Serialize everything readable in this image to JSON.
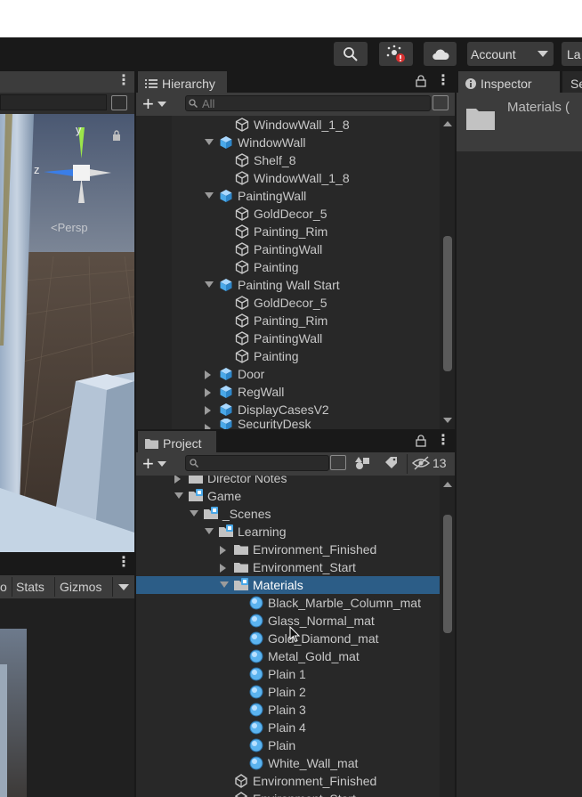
{
  "toolbar": {
    "account_label": "Account",
    "layers_label": "La",
    "search_icon": "search-icon",
    "collab_icon": "collab-icon",
    "cloud_icon": "cloud-icon"
  },
  "scene": {
    "gizmo_y": "y",
    "gizmo_z": "z",
    "persp_label": "<Persp"
  },
  "game": {
    "toolbar_partial": "o",
    "stats_label": "Stats",
    "gizmos_label": "Gizmos"
  },
  "hierarchy": {
    "tab_label": "Hierarchy",
    "search_placeholder": "All",
    "items": [
      {
        "label": "WindowWall_1_8",
        "type": "mesh"
      },
      {
        "label": "WindowWall",
        "type": "prefab"
      },
      {
        "label": "Shelf_8",
        "type": "mesh"
      },
      {
        "label": "WindowWall_1_8",
        "type": "mesh"
      },
      {
        "label": "PaintingWall",
        "type": "prefab"
      },
      {
        "label": "GoldDecor_5",
        "type": "mesh"
      },
      {
        "label": "Painting_Rim",
        "type": "mesh"
      },
      {
        "label": "PaintingWall",
        "type": "mesh"
      },
      {
        "label": "Painting",
        "type": "mesh"
      },
      {
        "label": "Painting Wall Start",
        "type": "prefab"
      },
      {
        "label": "GoldDecor_5",
        "type": "mesh"
      },
      {
        "label": "Painting_Rim",
        "type": "mesh"
      },
      {
        "label": "PaintingWall",
        "type": "mesh"
      },
      {
        "label": "Painting",
        "type": "mesh"
      },
      {
        "label": "Door",
        "type": "prefab"
      },
      {
        "label": "RegWall",
        "type": "prefab"
      },
      {
        "label": "DisplayCasesV2",
        "type": "prefab"
      },
      {
        "label": "SecurityDesk",
        "type": "prefab"
      }
    ]
  },
  "project": {
    "tab_label": "Project",
    "hidden_count": "13",
    "items": [
      {
        "label": "Director Notes",
        "type": "folder"
      },
      {
        "label": "Game",
        "type": "folder-scene"
      },
      {
        "label": "_Scenes",
        "type": "folder-scene"
      },
      {
        "label": "Learning",
        "type": "folder-scene"
      },
      {
        "label": "Environment_Finished",
        "type": "folder"
      },
      {
        "label": "Environment_Start",
        "type": "folder"
      },
      {
        "label": "Materials",
        "type": "folder-scene"
      },
      {
        "label": "Black_Marble_Column_mat",
        "type": "material"
      },
      {
        "label": "Glass_Normal_mat",
        "type": "material"
      },
      {
        "label": "Gold_Diamond_mat",
        "type": "material"
      },
      {
        "label": "Metal_Gold_mat",
        "type": "material"
      },
      {
        "label": "Plain 1",
        "type": "material"
      },
      {
        "label": "Plain 2",
        "type": "material"
      },
      {
        "label": "Plain 3",
        "type": "material"
      },
      {
        "label": "Plain 4",
        "type": "material"
      },
      {
        "label": "Plain",
        "type": "material"
      },
      {
        "label": "White_Wall_mat",
        "type": "material"
      },
      {
        "label": "Environment_Finished",
        "type": "scene"
      },
      {
        "label": "Environment_Start",
        "type": "scene"
      }
    ]
  },
  "inspector": {
    "tab_label": "Inspector",
    "tab2_label": "Se",
    "asset_name": "Materials ("
  },
  "colors": {
    "selection": "#2c5d87",
    "panel": "#282828",
    "background": "#191919",
    "accent_blue": "#4aa8e8"
  }
}
